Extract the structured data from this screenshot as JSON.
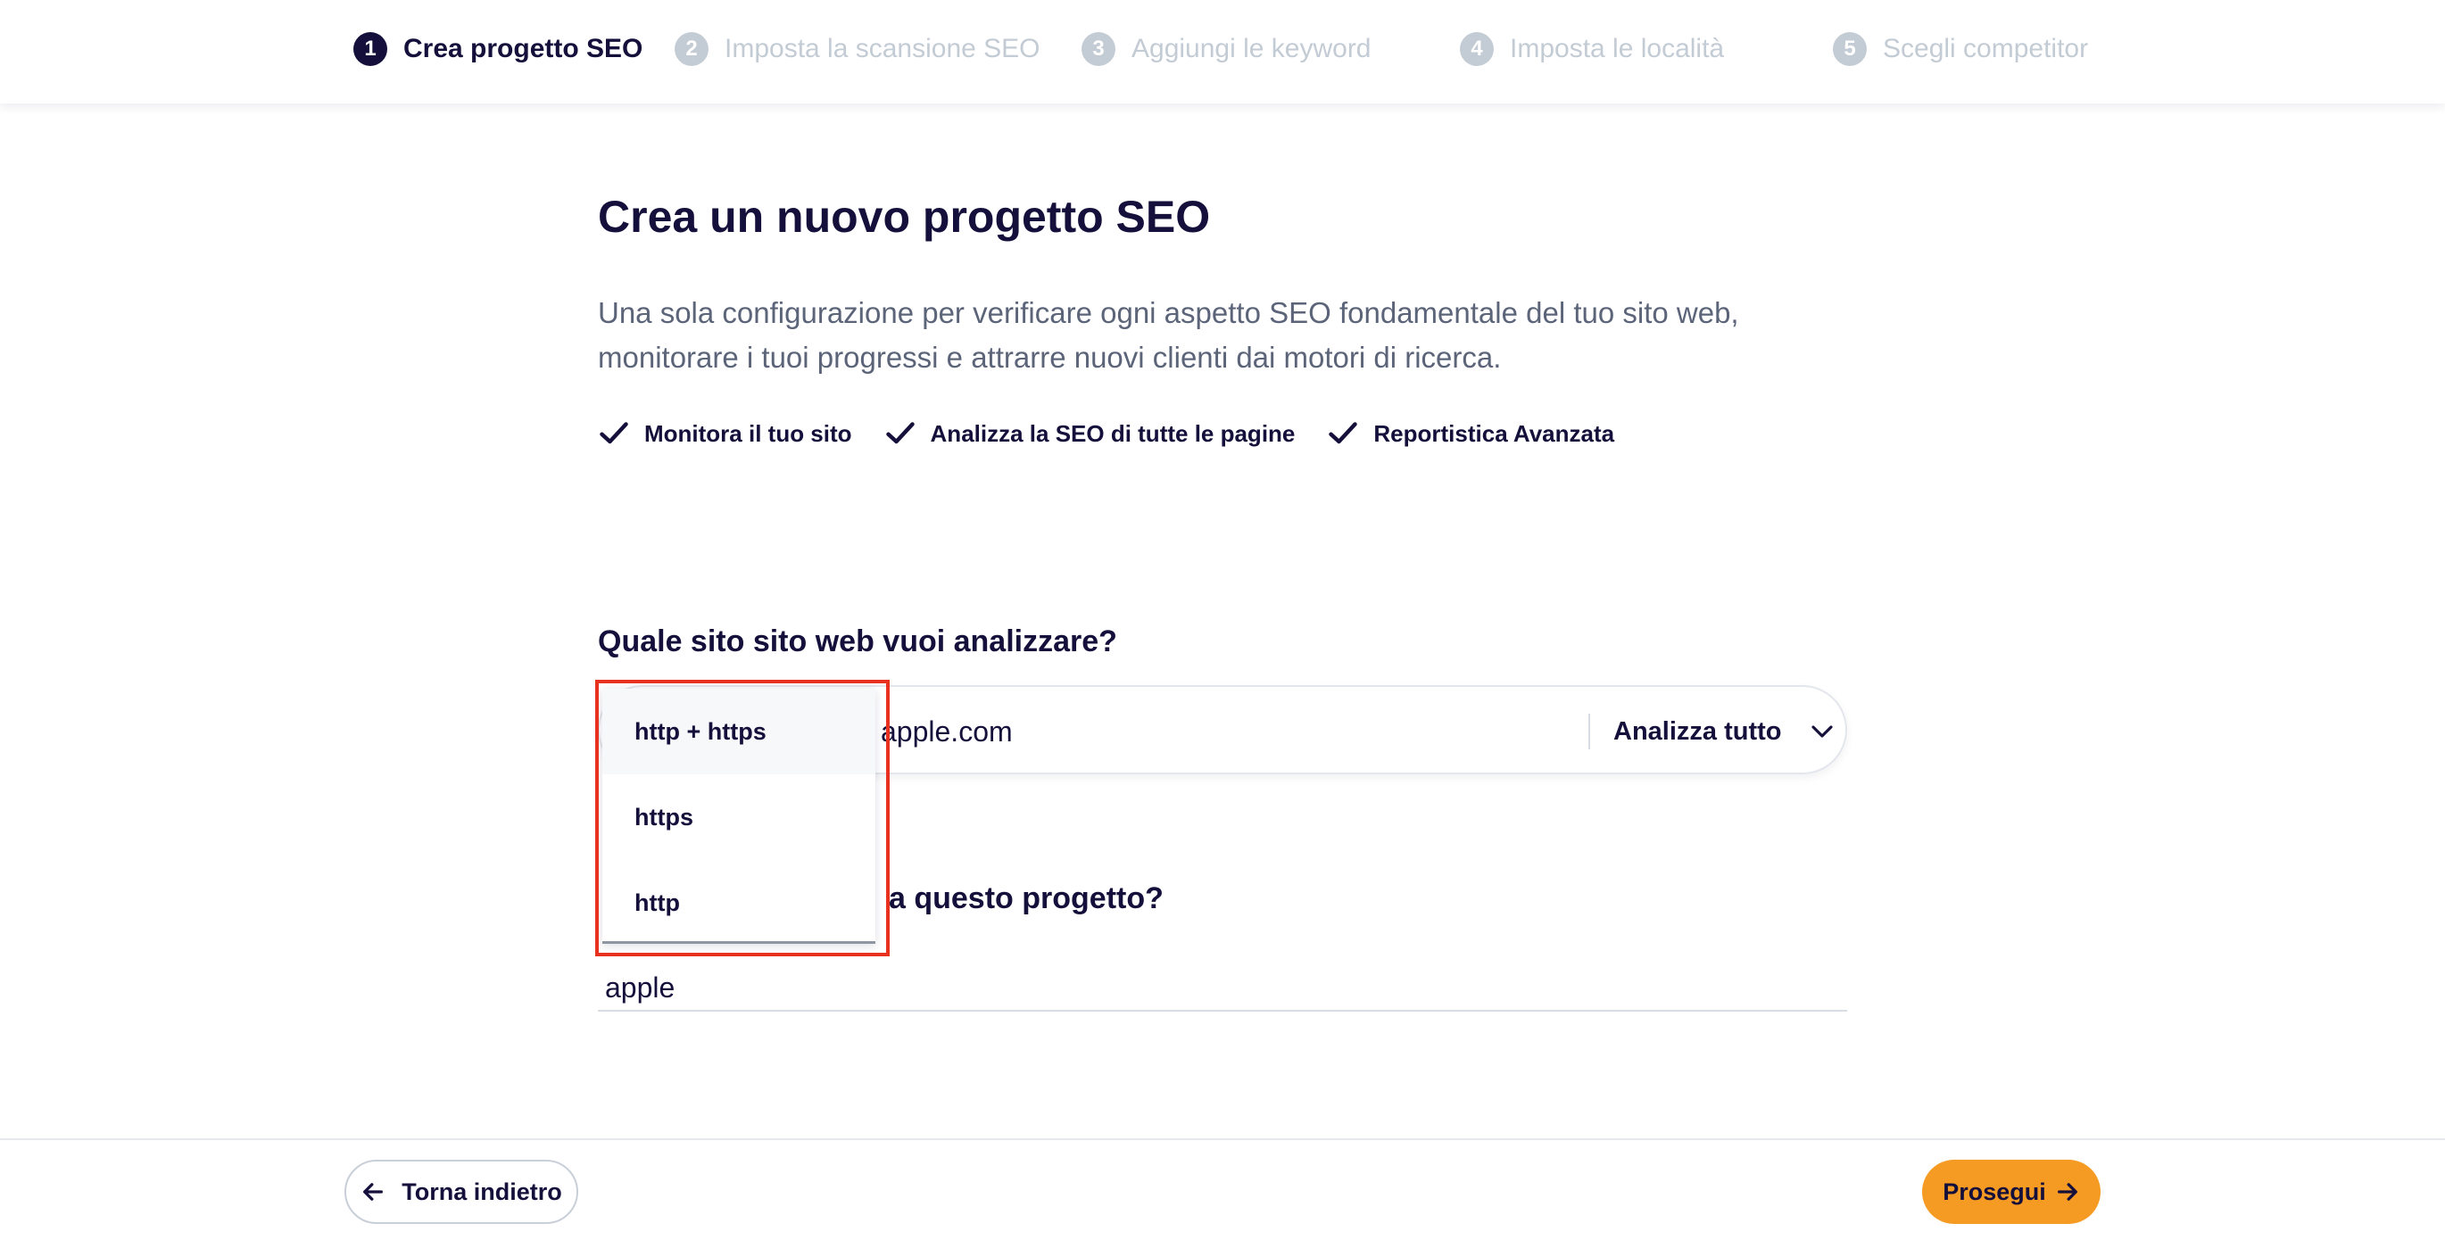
{
  "steps": [
    {
      "number": "1",
      "label": "Crea progetto SEO",
      "active": true
    },
    {
      "number": "2",
      "label": "Imposta la scansione SEO",
      "active": false
    },
    {
      "number": "3",
      "label": "Aggiungi le keyword",
      "active": false
    },
    {
      "number": "4",
      "label": "Imposta le località",
      "active": false
    },
    {
      "number": "5",
      "label": "Scegli competitor",
      "active": false
    }
  ],
  "main": {
    "title": "Crea un nuovo progetto SEO",
    "description": "Una sola configurazione per verificare ogni aspetto SEO fondamentale del tuo sito web, monitorare i tuoi progressi e attrarre nuovi clienti dai motori di ricerca.",
    "features": [
      "Monitora il tuo sito",
      "Analizza la SEO di tutte le pagine",
      "Reportistica Avanzata"
    ]
  },
  "website": {
    "question": "Quale sito sito web vuoi analizzare?",
    "url_value": "apple.com",
    "scope_value": "Analizza tutto"
  },
  "protocol_dropdown": {
    "options": [
      "http + https",
      "https",
      "http"
    ],
    "selected": "http + https"
  },
  "project_name": {
    "question_visible": "a questo progetto?",
    "value": "apple"
  },
  "footer": {
    "back_label": "Torna indietro",
    "next_label": "Prosegui"
  },
  "colors": {
    "primary": "#14103b",
    "accent": "#f59a23",
    "muted": "#c3cbd4",
    "highlight": "#e8321f"
  }
}
